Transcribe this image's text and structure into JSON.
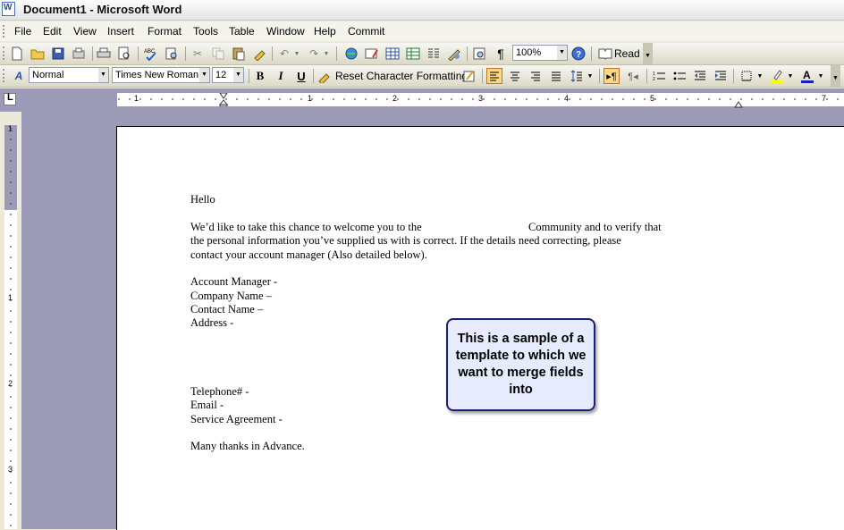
{
  "window": {
    "title": "Document1 - Microsoft Word"
  },
  "menu": [
    "File",
    "Edit",
    "View",
    "Insert",
    "Format",
    "Tools",
    "Table",
    "Window",
    "Help",
    "Commit"
  ],
  "standard_toolbar": {
    "zoom": "100%",
    "read_label": "Read"
  },
  "formatting_toolbar": {
    "style": "Normal",
    "font": "Times New Roman",
    "size": "12",
    "bold": "B",
    "italic": "I",
    "underline": "U",
    "reset_label": "Reset Character Formatting"
  },
  "ruler": {
    "h_numbers": [
      "1",
      "1",
      "2",
      "3",
      "4",
      "5",
      "7"
    ],
    "v_numbers": [
      "1",
      "1",
      "2",
      "3"
    ]
  },
  "document": {
    "lines": [
      "Hello",
      "We’d like to take this chance to welcome you to the",
      "Community and to verify that",
      "the personal information you’ve supplied us with is correct. If the details need correcting, please",
      "contact your account manager (Also detailed below).",
      "Account Manager -",
      "Company Name –",
      "Contact Name –",
      "Address -",
      "Telephone# -",
      "Email -",
      "Service Agreement -",
      "Many thanks in Advance."
    ]
  },
  "callout": {
    "text": "This is a sample of a template to which we want to merge fields into"
  }
}
